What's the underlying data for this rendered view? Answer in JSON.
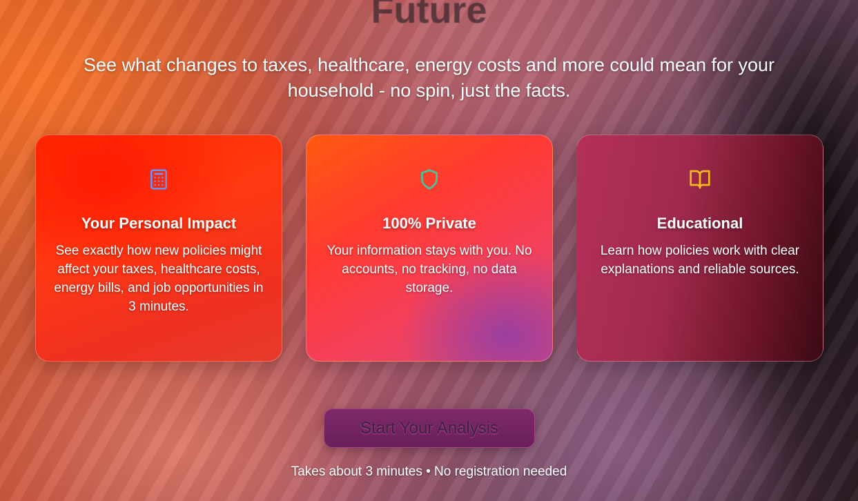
{
  "hero": {
    "title": "Future",
    "subtitle": "See what changes to taxes, healthcare, energy costs and more could mean for your household - no spin, just the facts."
  },
  "cards": [
    {
      "icon": "calculator-icon",
      "icon_color": "#6f8ff0",
      "title": "Your Personal Impact",
      "text": "See exactly how new policies might affect your taxes, healthcare costs, energy bills, and job opportunities in 3 minutes."
    },
    {
      "icon": "shield-icon",
      "icon_color": "#3fc8a0",
      "title": "100% Private",
      "text": "Your information stays with you. No accounts, no tracking, no data storage."
    },
    {
      "icon": "book-open-icon",
      "icon_color": "#f5b820",
      "title": "Educational",
      "text": "Learn how policies work with clear explanations and reliable sources."
    }
  ],
  "cta": {
    "label": "Start Your Analysis"
  },
  "footer": {
    "note": "Takes about 3 minutes • No registration needed"
  }
}
